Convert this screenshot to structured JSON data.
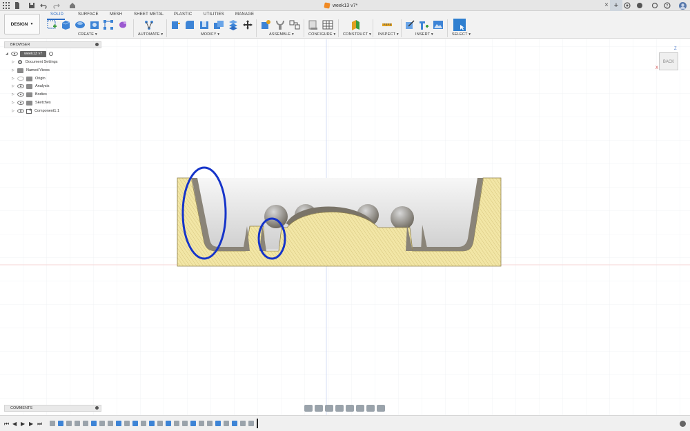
{
  "window": {
    "document_title": "week13 v7*",
    "close_glyph": "×",
    "new_tab_glyph": "+"
  },
  "ribbon": {
    "workspace_button": "DESIGN",
    "tabs": [
      "SOLID",
      "SURFACE",
      "MESH",
      "SHEET METAL",
      "PLASTIC",
      "UTILITIES",
      "MANAGE"
    ],
    "active_tab": "SOLID",
    "groups": [
      {
        "label": "CREATE"
      },
      {
        "label": "AUTOMATE"
      },
      {
        "label": "MODIFY"
      },
      {
        "label": "ASSEMBLE"
      },
      {
        "label": "CONFIGURE"
      },
      {
        "label": "CONSTRUCT"
      },
      {
        "label": "INSPECT"
      },
      {
        "label": "INSERT"
      },
      {
        "label": "SELECT"
      }
    ]
  },
  "browser": {
    "title": "BROWSER",
    "root": "week13 v7",
    "items": [
      {
        "label": "Document Settings",
        "icon": "gear-icon"
      },
      {
        "label": "Named Views",
        "icon": "folder-icon"
      },
      {
        "label": "Origin",
        "icon": "folder-icon"
      },
      {
        "label": "Analysis",
        "icon": "folder-icon"
      },
      {
        "label": "Bodies",
        "icon": "folder-icon"
      },
      {
        "label": "Sketches",
        "icon": "folder-icon"
      },
      {
        "label": "Component1:1",
        "icon": "component-icon"
      }
    ]
  },
  "viewcube": {
    "face": "BACK",
    "axis_z": "Z",
    "axis_x": "X"
  },
  "comments": {
    "title": "COMMENTS"
  },
  "colors": {
    "accent": "#2b6cc4",
    "section_fill": "#f2e6a6",
    "annotation": "#1634c9"
  }
}
